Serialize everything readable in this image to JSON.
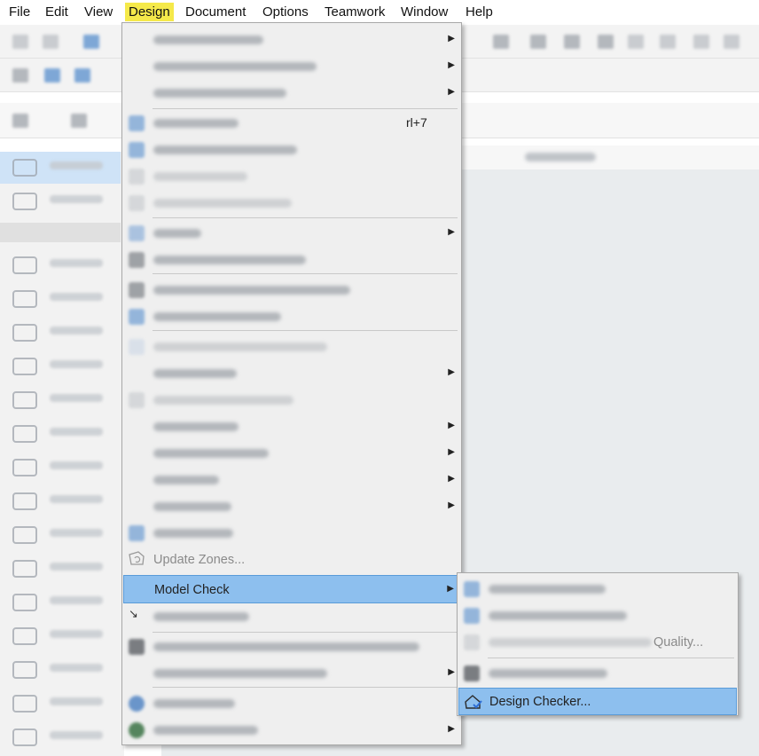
{
  "menubar": {
    "items": [
      "File",
      "Edit",
      "View",
      "Design",
      "Document",
      "Options",
      "Teamwork",
      "Window",
      "Help"
    ],
    "active": "Design",
    "active_color": "#f5e94a"
  },
  "design_menu": {
    "shortcut_fragment": "rl+7",
    "update_zones": "Update Zones...",
    "model_check": "Model Check"
  },
  "model_check_submenu": {
    "partial_item": "Quality...",
    "design_checker": "Design Checker..."
  },
  "colors": {
    "highlight": "#8dbfee",
    "highlight_border": "#5a9bd8",
    "menu_bg": "#efefef",
    "canvas_bg": "#e9ecee"
  },
  "icons": {
    "update_zones": "zone-refresh-icon",
    "model_check": "check-icon",
    "design_checker": "house-check-icon"
  }
}
